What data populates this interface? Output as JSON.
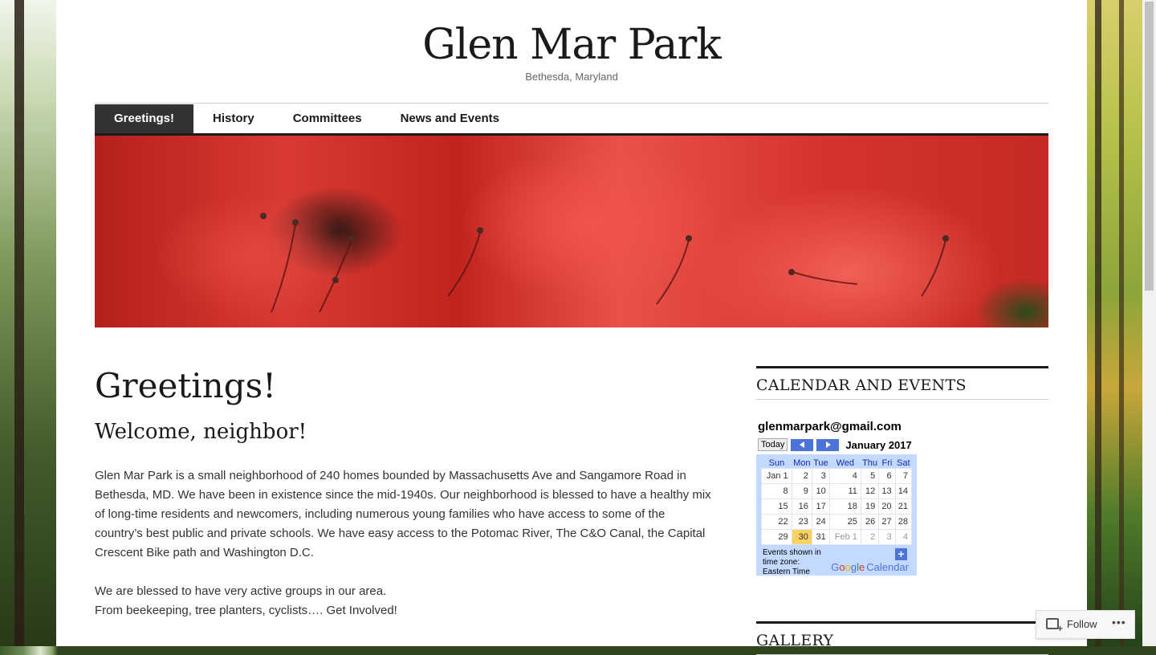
{
  "site": {
    "title": "Glen Mar Park",
    "tagline": "Bethesda, Maryland"
  },
  "nav": {
    "items": [
      {
        "label": "Greetings!",
        "active": true
      },
      {
        "label": "History",
        "active": false
      },
      {
        "label": "Committees",
        "active": false
      },
      {
        "label": "News and Events",
        "active": false
      }
    ]
  },
  "entry": {
    "title": "Greetings!",
    "subtitle": "Welcome, neighbor!",
    "para1": "Glen Mar Park is a small neighborhood of 240 homes bounded by Massachusetts Ave and Sangamore Road in Bethesda, MD. We have been in existence since the mid-1940s. Our neighborhood is blessed to have a healthy mix of long-time residents and newcomers, including numerous young families who have access to some of the country’s best public and private schools. We have easy access to the Potomac River, The C&O Canal, the Capital Crescent Bike path and Washington D.C.",
    "para2_line1": "We are blessed to have very active groups in our area.",
    "para2_line2": "From beekeeping, tree planters, cyclists…. Get Involved!"
  },
  "sidebar": {
    "calendar_widget_title": "CALENDAR AND EVENTS",
    "gallery_widget_title": "GALLERY"
  },
  "gcal": {
    "calendar_name": "glenmarpark@gmail.com",
    "today_label": "Today",
    "month_label": "January 2017",
    "weekdays": [
      "Sun",
      "Mon",
      "Tue",
      "Wed",
      "Thu",
      "Fri",
      "Sat"
    ],
    "weeks": [
      [
        "Jan 1",
        "2",
        "3",
        "4",
        "5",
        "6",
        "7"
      ],
      [
        "8",
        "9",
        "10",
        "11",
        "12",
        "13",
        "14"
      ],
      [
        "15",
        "16",
        "17",
        "18",
        "19",
        "20",
        "21"
      ],
      [
        "22",
        "23",
        "24",
        "25",
        "26",
        "27",
        "28"
      ],
      [
        "29",
        "30",
        "31",
        "Feb 1",
        "2",
        "3",
        "4"
      ]
    ],
    "timezone_line1": "Events shown in",
    "timezone_line2": "time zone:",
    "timezone_line3": "Eastern Time",
    "logo_text": "Google",
    "logo_suffix": "Calendar"
  },
  "follow": {
    "label": "Follow",
    "more": "•••"
  },
  "colors": {
    "nav_active_bg": "#333333",
    "gcal_bg": "#c3d9ff",
    "gcal_today": "#fad163",
    "hero_red": "#d83a33"
  }
}
